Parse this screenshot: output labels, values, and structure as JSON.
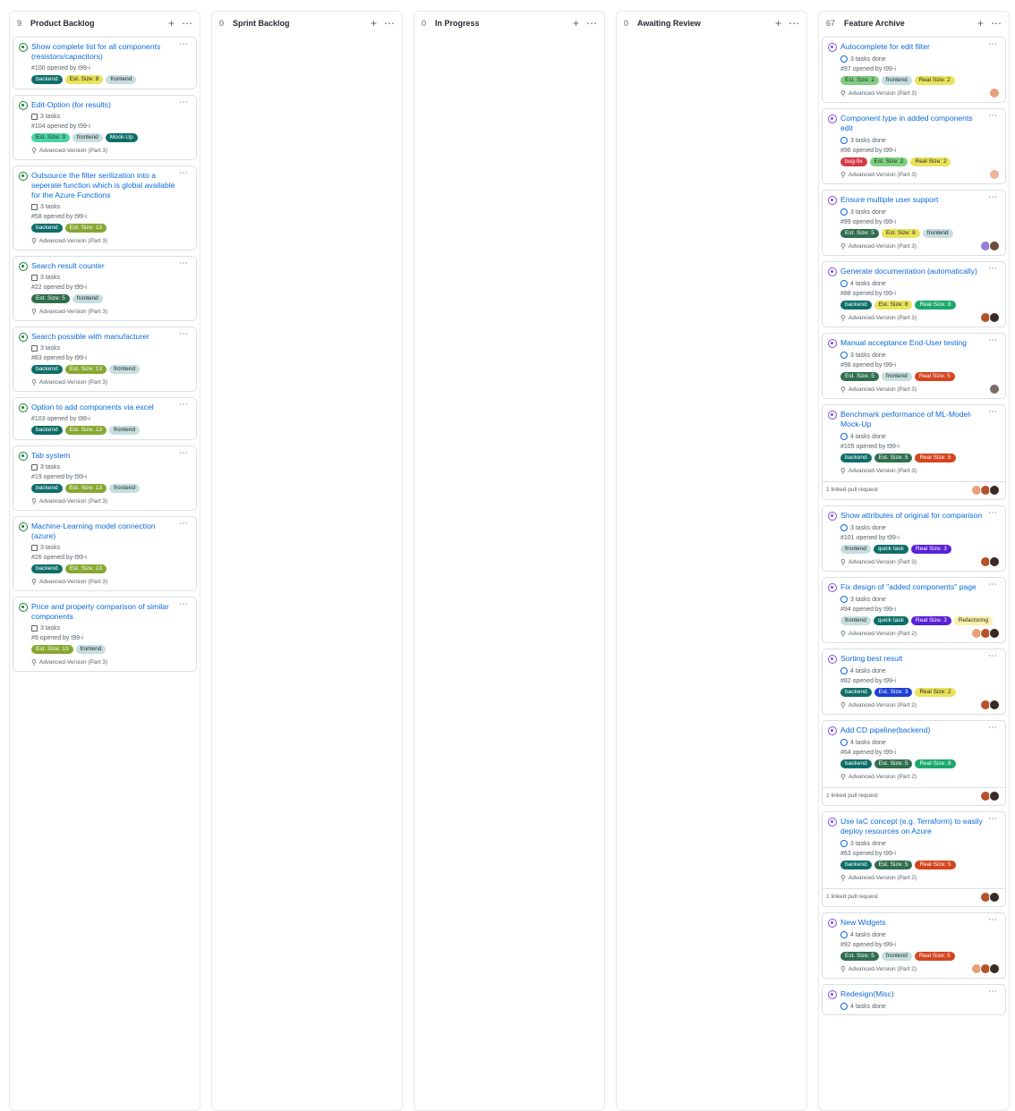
{
  "columns": [
    {
      "id": "product-backlog",
      "count": "9",
      "title": "Product Backlog",
      "cards": [
        {
          "title": "Show complete list for all components (resistors/capacitors)",
          "state": "open",
          "tasks": "",
          "issue": "#100 opened by t99-i",
          "labels": [
            "backend",
            "Est. Size: 8",
            "frontend"
          ],
          "milestone": "",
          "avatars": [],
          "linked": ""
        },
        {
          "title": "Edit-Option (for results)",
          "state": "open",
          "tasks": "3 tasks",
          "issue": "#104 opened by t99-i",
          "labels": [
            "Est. Size: 3",
            "frontend",
            "Mock-Up"
          ],
          "milestone": "Advanced-Version (Part 3)",
          "avatars": [],
          "linked": ""
        },
        {
          "title": "Outsource the filter serilization into a seperate function which is global available for the Azure Functions",
          "state": "open",
          "tasks": "3 tasks",
          "issue": "#58 opened by t99-i",
          "labels": [
            "backend",
            "Est. Size: 13"
          ],
          "milestone": "Advanced-Version (Part 3)",
          "avatars": [],
          "linked": ""
        },
        {
          "title": "Search result counter",
          "state": "open",
          "tasks": "3 tasks",
          "issue": "#22 opened by t99-i",
          "labels": [
            "Est. Size: 5",
            "frontend"
          ],
          "milestone": "Advanced-Version (Part 3)",
          "avatars": [],
          "linked": ""
        },
        {
          "title": "Search possible with manufacturer",
          "state": "open",
          "tasks": "3 tasks",
          "issue": "#83 opened by t99-i",
          "labels": [
            "backend",
            "Est. Size: 13",
            "frontend"
          ],
          "milestone": "Advanced-Version (Part 3)",
          "avatars": [],
          "linked": ""
        },
        {
          "title": "Option to add components via excel",
          "state": "open",
          "tasks": "",
          "issue": "#103 opened by t99-i",
          "labels": [
            "backend",
            "Est. Size: 13",
            "frontend"
          ],
          "milestone": "",
          "avatars": [],
          "linked": ""
        },
        {
          "title": "Tab system",
          "state": "open",
          "tasks": "3 tasks",
          "issue": "#19 opened by t99-i",
          "labels": [
            "backend",
            "Est. Size: 13",
            "frontend"
          ],
          "milestone": "Advanced-Version (Part 3)",
          "avatars": [],
          "linked": ""
        },
        {
          "title": "Machine-Learning model connection (azure)",
          "state": "open",
          "tasks": "3 tasks",
          "issue": "#26 opened by t99-i",
          "labels": [
            "backend",
            "Est. Size: 13"
          ],
          "milestone": "Advanced-Version (Part 3)",
          "avatars": [],
          "linked": ""
        },
        {
          "title": "Price and property comparison of similar components",
          "state": "open",
          "tasks": "3 tasks",
          "issue": "#9 opened by t99-i",
          "labels": [
            "Est. Size: 13",
            "frontend"
          ],
          "milestone": "Advanced-Version (Part 3)",
          "avatars": [],
          "linked": ""
        }
      ]
    },
    {
      "id": "sprint-backlog",
      "count": "0",
      "title": "Sprint Backlog",
      "cards": []
    },
    {
      "id": "in-progress",
      "count": "0",
      "title": "In Progress",
      "cards": []
    },
    {
      "id": "awaiting-review",
      "count": "0",
      "title": "Awaiting Review",
      "cards": []
    },
    {
      "id": "feature-archive",
      "count": "67",
      "title": "Feature Archive",
      "cards": [
        {
          "title": "Autocomplete for edit filter",
          "state": "closed",
          "tasks": "3 tasks done",
          "issue": "#97 opened by t99-i",
          "labels": [
            "Est. Size: 2",
            "frontend",
            "Real Size: 2"
          ],
          "milestone": "Advanced-Version (Part 3)",
          "avatars": [
            "#e8a07a"
          ],
          "linked": ""
        },
        {
          "title": "Component type in added components edit",
          "state": "closed",
          "tasks": "3 tasks done",
          "issue": "#96 opened by t99-i",
          "labels": [
            "bug-fix",
            "Est. Size: 2",
            "Real Size: 2"
          ],
          "milestone": "Advanced-Version (Part 3)",
          "avatars": [
            "#f0b49a"
          ],
          "linked": ""
        },
        {
          "title": "Ensure multiple user support",
          "state": "closed",
          "tasks": "3 tasks done",
          "issue": "#99 opened by t99-i",
          "labels": [
            "Est. Size: 5",
            "Est. Size: 8",
            "frontend"
          ],
          "milestone": "Advanced-Version (Part 3)",
          "avatars": [
            "#9a7fd6",
            "#6e4a3a"
          ],
          "linked": ""
        },
        {
          "title": "Generate documentation (automatically)",
          "state": "closed",
          "tasks": "4 tasks done",
          "issue": "#88 opened by t99-i",
          "labels": [
            "backend",
            "Est. Size: 8",
            "Real Size: 8"
          ],
          "milestone": "Advanced-Version (Part 3)",
          "avatars": [
            "#b5522a",
            "#3a2a25"
          ],
          "linked": ""
        },
        {
          "title": "Manual acceptance End-User testing",
          "state": "closed",
          "tasks": "3 tasks done",
          "issue": "#98 opened by t99-i",
          "labels": [
            "Est. Size: 5",
            "frontend",
            "Real Size: 5"
          ],
          "milestone": "Advanced-Version (Part 3)",
          "avatars": [
            "#7a6a62"
          ],
          "linked": ""
        },
        {
          "title": "Benchmark performance of ML-Model-Mock-Up",
          "state": "closed",
          "tasks": "4 tasks done",
          "issue": "#105 opened by t99-i",
          "labels": [
            "backend",
            "Est. Size: 5",
            "Real Size: 5"
          ],
          "milestone": "Advanced-Version (Part 3)",
          "avatars": [
            "#e8a07a",
            "#b5522a",
            "#3a2a25"
          ],
          "linked": "1 linked pull request"
        },
        {
          "title": "Show attributes of original for comparison",
          "state": "closed",
          "tasks": "3 tasks done",
          "issue": "#101 opened by t99-i",
          "labels": [
            "frontend",
            "quick task",
            "Real Size: 3"
          ],
          "milestone": "Advanced-Version (Part 3)",
          "avatars": [
            "#b5522a",
            "#3a2a25"
          ],
          "linked": ""
        },
        {
          "title": "Fix design of \"added components\" page",
          "state": "closed",
          "tasks": "3 tasks done",
          "issue": "#94 opened by t99-i",
          "labels": [
            "frontend",
            "quick task",
            "Real Size: 3",
            "Refactoring"
          ],
          "milestone": "Advanced-Version (Part 2)",
          "avatars": [
            "#e8a07a",
            "#b5522a",
            "#3a2a25"
          ],
          "linked": ""
        },
        {
          "title": "Sorting best result",
          "state": "closed",
          "tasks": "4 tasks done",
          "issue": "#82 opened by t99-i",
          "labels": [
            "backend",
            "Est. Size: 3",
            "Real Size: 2"
          ],
          "milestone": "Advanced-Version (Part 2)",
          "avatars": [
            "#b5522a",
            "#3a2a25"
          ],
          "linked": ""
        },
        {
          "title": "Add CD pipeline(backend)",
          "state": "closed",
          "tasks": "4 tasks done",
          "issue": "#64 opened by t99-i",
          "labels": [
            "backend",
            "Est. Size: 5",
            "Real Size: 8"
          ],
          "milestone": "Advanced-Version (Part 2)",
          "avatars": [
            "#b5522a",
            "#3a2a25"
          ],
          "linked": "1 linked pull request"
        },
        {
          "title": "Use IaC concept (e.g. Terraform) to easily deploy resources on Azure",
          "state": "closed",
          "tasks": "3 tasks done",
          "issue": "#63 opened by t99-i",
          "labels": [
            "backend",
            "Est. Size: 5",
            "Real Size: 5"
          ],
          "milestone": "Advanced-Version (Part 2)",
          "avatars": [
            "#b5522a",
            "#3a2a25"
          ],
          "linked": "1 linked pull request"
        },
        {
          "title": "New Widgets",
          "state": "closed",
          "tasks": "4 tasks done",
          "issue": "#92 opened by t99-i",
          "labels": [
            "Est. Size: 5",
            "frontend",
            "Real Size: 5"
          ],
          "milestone": "Advanced-Version (Part 2)",
          "avatars": [
            "#e8a07a",
            "#b5522a",
            "#3a2a25"
          ],
          "linked": ""
        },
        {
          "title": "Redesign(Misc)",
          "state": "closed",
          "tasks": "4 tasks done",
          "issue": "",
          "labels": [],
          "milestone": "",
          "avatars": [],
          "linked": ""
        }
      ]
    }
  ],
  "label_colors": {
    "backend": {
      "bg": "#0e6e6a",
      "fg": "#ffffff"
    },
    "frontend": {
      "bg": "#c5dede",
      "fg": "#1f2328"
    },
    "Mock-Up": {
      "bg": "#0e6e6a",
      "fg": "#ffffff"
    },
    "bug-fix": {
      "bg": "#d73a4a",
      "fg": "#ffffff"
    },
    "quick task": {
      "bg": "#0e6e6a",
      "fg": "#ffffff"
    },
    "Refactoring": {
      "bg": "#fbf1a9",
      "fg": "#1f2328"
    },
    "Est. Size: 2": {
      "bg": "#7ed07e",
      "fg": "#1f2328"
    },
    "Est. Size: 3": {
      "bg": "#4ad3a0",
      "fg": "#1f2328"
    },
    "Est. Size: 5": {
      "bg": "#2f6e4e",
      "fg": "#ffffff"
    },
    "Est. Size: 8": {
      "bg": "#e9e35a",
      "fg": "#1f2328"
    },
    "Est. Size: 13": {
      "bg": "#86a832",
      "fg": "#ffffff"
    },
    "Real Size: 2": {
      "bg": "#e9e35a",
      "fg": "#1f2328"
    },
    "Real Size: 3": {
      "bg": "#5a1fd6",
      "fg": "#ffffff"
    },
    "Real Size: 5": {
      "bg": "#d4441d",
      "fg": "#ffffff"
    },
    "Real Size: 8": {
      "bg": "#19a86a",
      "fg": "#ffffff"
    },
    "Est. Size: 3 (blue)": {
      "bg": "#1d3fd6",
      "fg": "#ffffff"
    }
  }
}
